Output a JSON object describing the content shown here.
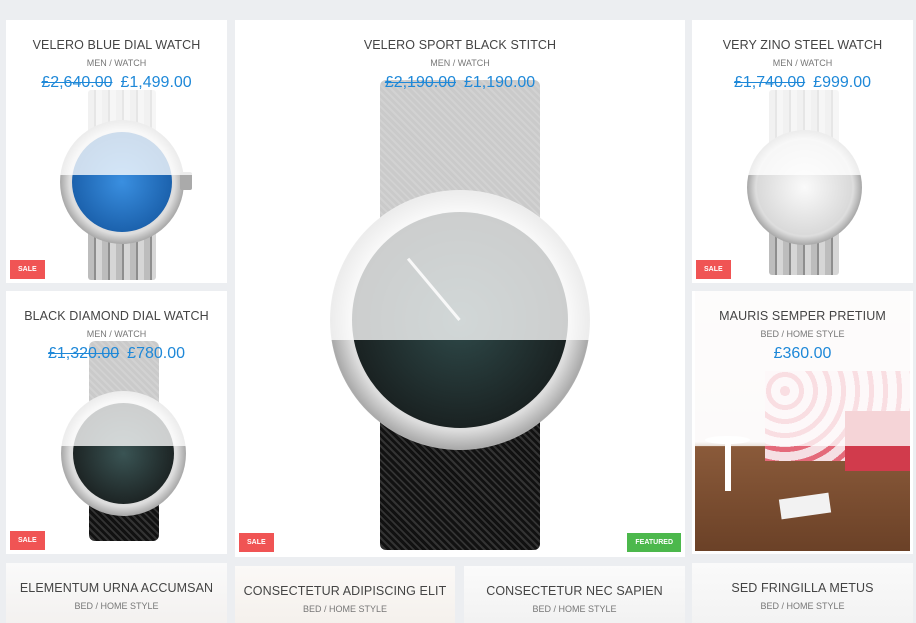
{
  "products": [
    {
      "title": "VELERO BLUE DIAL WATCH",
      "cat1": "MEN",
      "cat2": "WATCH",
      "old_price": "£2,640.00",
      "price": "£1,499.00",
      "badge": "SALE"
    },
    {
      "title": "VELERO SPORT BLACK STITCH",
      "cat1": "MEN",
      "cat2": "WATCH",
      "old_price": "£2,190.00",
      "price": "£1,190.00",
      "badge": "SALE",
      "badge2": "FEATURED"
    },
    {
      "title": "VERY ZINO STEEL WATCH",
      "cat1": "MEN",
      "cat2": "WATCH",
      "old_price": "£1,740.00",
      "price": "£999.00",
      "badge": "SALE"
    },
    {
      "title": "BLACK DIAMOND DIAL WATCH",
      "cat1": "MEN",
      "cat2": "WATCH",
      "old_price": "£1,320.00",
      "price": "£780.00",
      "badge": "SALE"
    },
    {
      "title": "MAURIS SEMPER PRETIUM",
      "cat1": "BED",
      "cat2": "HOME STYLE",
      "price": "£360.00"
    },
    {
      "title": "ELEMENTUM URNA ACCUMSAN",
      "cat1": "BED",
      "cat2": "HOME STYLE"
    },
    {
      "title": "CONSECTETUR ADIPISCING ELIT",
      "cat1": "BED",
      "cat2": "HOME STYLE"
    },
    {
      "title": "CONSECTETUR NEC SAPIEN",
      "cat1": "BED",
      "cat2": "HOME STYLE"
    },
    {
      "title": "SED FRINGILLA METUS",
      "cat1": "BED",
      "cat2": "HOME STYLE"
    }
  ],
  "separator": "/",
  "colors": {
    "price": "#1e88d8",
    "sale": "#f05454",
    "featured": "#4cb84c"
  }
}
